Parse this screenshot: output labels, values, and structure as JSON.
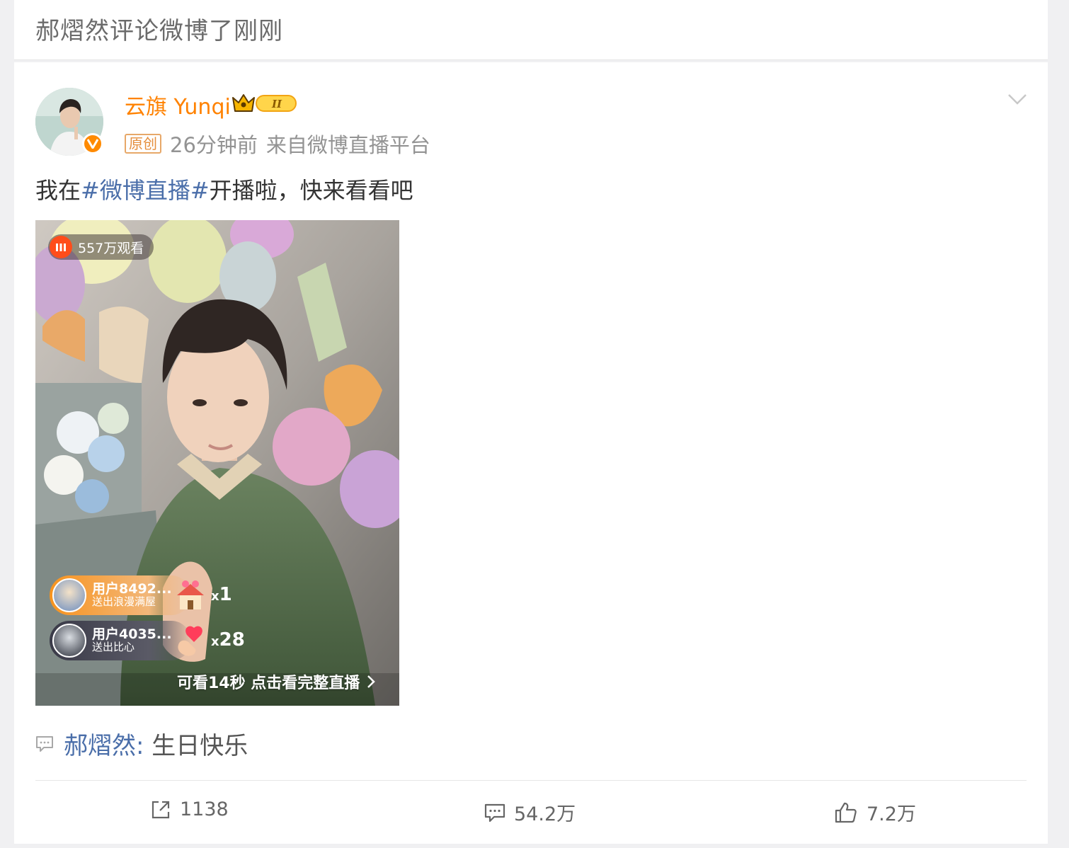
{
  "notice": {
    "text": "郝熠然评论微博了刚刚"
  },
  "post": {
    "author": {
      "name": "云旗 Yunqi",
      "verified": true,
      "level_badge": "II"
    },
    "meta": {
      "original_tag": "原创",
      "time": "26分钟前",
      "source": "来自微博直播平台"
    },
    "content": {
      "prefix": "我在",
      "hashtag": "#微博直播#",
      "suffix": "开播啦，快来看看吧"
    },
    "media": {
      "views": "557万观看",
      "gifts": [
        {
          "user": "用户8492...",
          "desc": "送出浪漫满屋",
          "count_prefix": "x",
          "count": "1"
        },
        {
          "user": "用户4035...",
          "desc": "送出比心",
          "count_prefix": "x",
          "count": "28"
        }
      ],
      "replay_text": "可看14秒 点击看完整直播"
    },
    "comment": {
      "author": "郝熠然",
      "separator": ":",
      "text": "生日快乐"
    },
    "actions": {
      "repost": "1138",
      "comments": "54.2万",
      "likes": "7.2万"
    }
  },
  "colors": {
    "username": "#ff8200",
    "link": "#4a6ea9",
    "live": "#ff4d1a",
    "gift_row_1": "#f7931e",
    "gift_row_2": "#3a3a48"
  },
  "icons": {
    "more": "chevron-down-icon",
    "repost": "share-icon",
    "comment": "comment-icon",
    "like": "thumbs-up-icon"
  }
}
